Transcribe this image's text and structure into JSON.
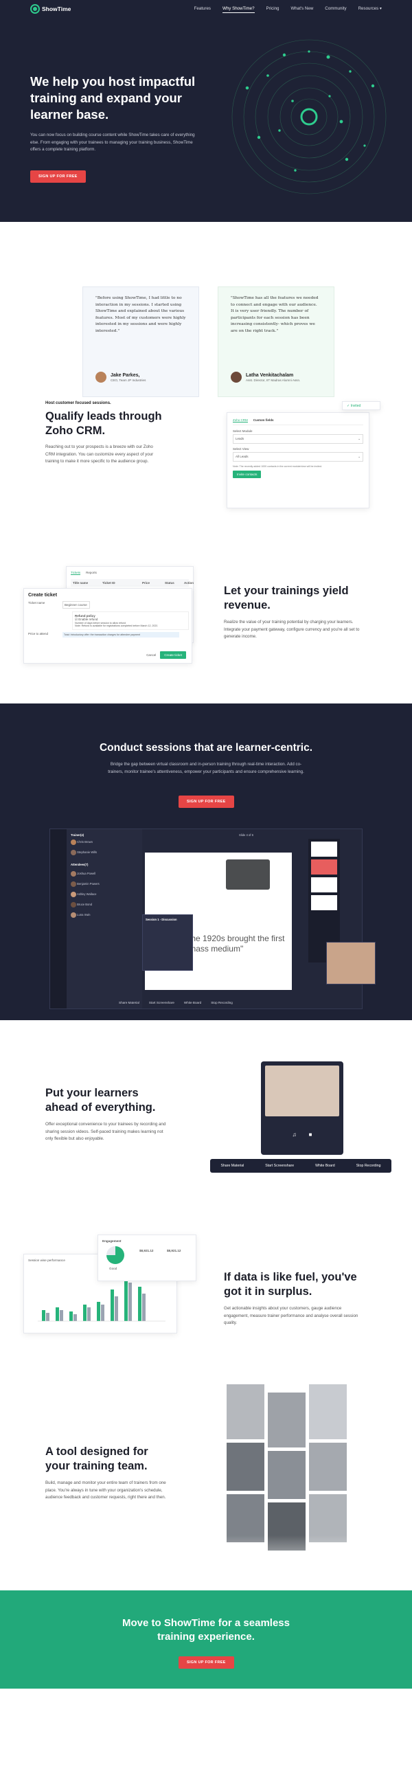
{
  "nav": {
    "brand": "ShowTime",
    "items": [
      "Features",
      "Why ShowTime?",
      "Pricing",
      "What's New",
      "Community",
      "Resources ▾"
    ],
    "active_index": 1
  },
  "hero": {
    "title": "We help you host impactful training and expand your learner base.",
    "body": "You can now focus on building course content while ShowTime takes care of everything else. From engaging with your trainees to managing your training business, ShowTime offers a complete training platform.",
    "cta": "SIGN UP FOR FREE"
  },
  "testimonials": [
    {
      "quote": "\"Before using ShowTime, I had little to no interaction in my sessions. I started using ShowTime and explained about the various features. Most of my customers were highly interested in my sessions and were highly interested.\"",
      "name": "Jake Parkes,",
      "role": "CEO, Team JP Industries"
    },
    {
      "quote": "\"ShowTime has all the features we needed to connect and engage with our audience. It is very user friendly. The number of participants for each session has been increasing consistently- which proves we are on the right track.\"",
      "name": "Latha Venkitachalam",
      "role": "Asst. Director, IIT Madras Alumni Assn."
    }
  ],
  "crm": {
    "kicker": "Host customer focused sessions.",
    "title": "Qualify leads through Zoho CRM.",
    "body": "Reaching out to your prospects is a breeze with our Zoho CRM integration. You can customize every aspect of your training to make it more specific to the audience group.",
    "mock": {
      "tab1": "Zoho CRM",
      "tab2": "Custom fields",
      "field1_label": "Select Module",
      "field1_value": "Leads",
      "field2_label": "Select View",
      "field2_value": "All Leads",
      "note": "Note: The recently added 1000 contacts in the current module/view will be invited.",
      "invite": "Invite contacts",
      "badge": "Invited"
    }
  },
  "revenue": {
    "title": "Let your trainings yield revenue.",
    "body": "Realize the value of your training potential by charging your learners. Integrate your payment gateway, configure currency and you're all set to generate income.",
    "mock": {
      "tabs": [
        "Tickets",
        "Reports"
      ],
      "columns": [
        "Title name",
        "Ticket ID",
        "Price",
        "Status",
        "Action"
      ],
      "row": [
        "Beginner course",
        "1706949398999234321",
        "$12,000",
        "Active",
        "✎"
      ],
      "dialog_title": "Create ticket",
      "ticket_name_label": "Ticket name",
      "ticket_name_value": "Beginner course",
      "price_label": "Price to attend",
      "refund_label": "Refund policy",
      "refund_option": "Enable refund",
      "refund_days": "Number of days before session to allow refund",
      "note": "Note: Refund is available for registrations completed before March 12, 2021",
      "save_note": "Total: Introductory offer: the transaction charges for attendee payment",
      "cancel": "Cancel",
      "create": "Create ticket"
    }
  },
  "sessions": {
    "title": "Conduct sessions that are learner-centric.",
    "body": "Bridge the gap between virtual classroom and in-person training through real-time interaction. Add co-trainers, monitor trainee's attentiveness, empower your participants and ensure comprehensive learning.",
    "cta": "SIGN UP FOR FREE",
    "app": {
      "title": "Trainer(4)",
      "tabs": [
        "Trainer(4)",
        "Attendees(7)"
      ],
      "slide_text": "The 1920s brought the first \"mass medium\"",
      "chat_title": "Session 1 - Discussion",
      "slide_counter": "Slide 4 of 6",
      "tools": [
        "Share Material",
        "Start Screenshare",
        "White Board",
        "Stop Recording"
      ],
      "people": [
        "Chris Brown",
        "Stephanie Wills",
        "Joshua Powell",
        "Benjamin Powers",
        "Ashley Wallace",
        "Bruce Bond",
        "Luna Irwin"
      ]
    }
  },
  "learners": {
    "title": "Put your learners ahead of everything.",
    "body": "Offer exceptional convenience to your trainees by recording and sharing session videos. Self-paced training makes learning not only flexible but also enjoyable.",
    "toolbar": [
      "Share Material",
      "Start Screenshare",
      "White Board",
      "Stop Recording"
    ]
  },
  "data": {
    "title": "If data is like fuel, you've got it in surplus.",
    "body": "Get actionable insights about your customers, gauge audience engagement, measure trainer performance and analyse overall session quality.",
    "engagement_title": "Engagement",
    "engagement_label": "Good",
    "engagement_value1": "$8,921.12",
    "engagement_value2": "$8,921.12",
    "chart_title": "Session wise performance"
  },
  "team": {
    "title": "A tool designed for your training team.",
    "body": "Build, manage and monitor your entire team of trainers from one place. You're always in tune with your organization's schedule, audience feedback and customer requests, right there and then."
  },
  "footer_cta": {
    "title": "Move to ShowTime for a seamless training experience.",
    "cta": "SIGN UP FOR FREE"
  },
  "colors": {
    "navy": "#1e2235",
    "accent_green": "#26b37a",
    "cta_red": "#e64545",
    "cta_band": "#22a97a"
  }
}
